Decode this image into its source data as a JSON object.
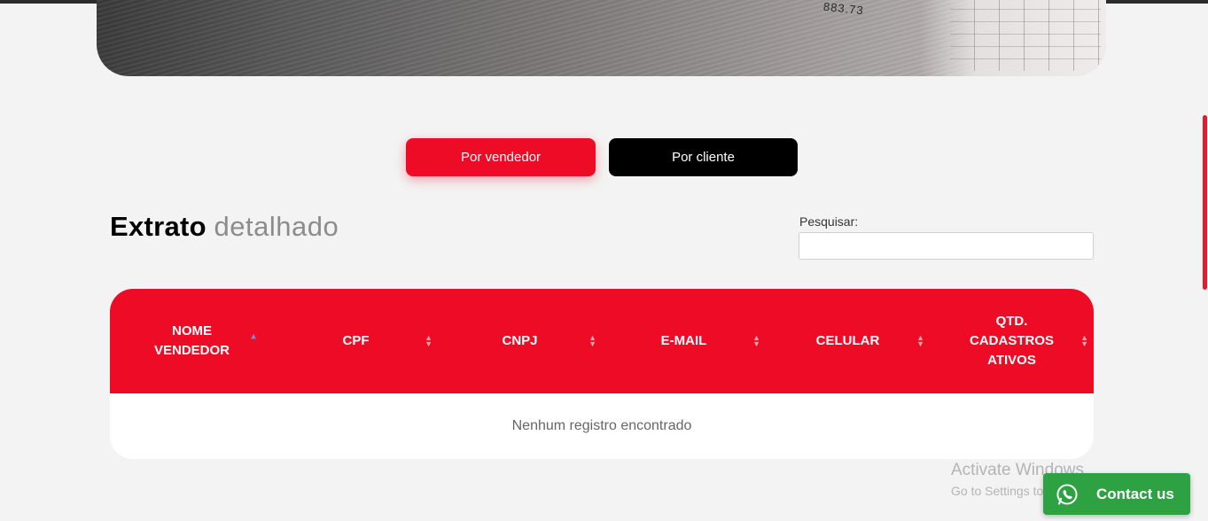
{
  "hero": {
    "number_fragment": "883.73"
  },
  "buttons": {
    "vendedor": "Por vendedor",
    "cliente": "Por cliente"
  },
  "section": {
    "title_bold": "Extrato",
    "title_light": "detalhado"
  },
  "search": {
    "label": "Pesquisar:",
    "value": ""
  },
  "table": {
    "headers": [
      {
        "label": "NOME VENDEDOR",
        "sort": "ascending"
      },
      {
        "label": "CPF",
        "sort": "both"
      },
      {
        "label": "CNPJ",
        "sort": "both"
      },
      {
        "label": "E-MAIL",
        "sort": "both"
      },
      {
        "label": "CELULAR",
        "sort": "both"
      },
      {
        "label": "QTD. CADASTROS ATIVOS",
        "sort": "both"
      }
    ],
    "empty_message": "Nenhum registro encontrado"
  },
  "watermark": {
    "line1": "Activate Windows",
    "line2": "Go to Settings to activate Windows."
  },
  "contact": {
    "label": "Contact us",
    "icon": "whatsapp-icon"
  },
  "colors": {
    "accent": "#ee0b25",
    "dark": "#000000",
    "whatsapp": "#2ea142"
  }
}
